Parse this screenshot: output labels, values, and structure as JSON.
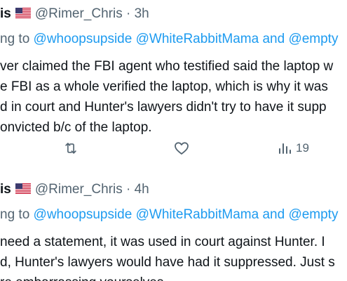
{
  "tweets": [
    {
      "display_name_fragment": "is",
      "handle": "@Rimer_Chris",
      "separator": "·",
      "time": "3h",
      "replying_prefix": "ng to",
      "mentions": [
        "@whoopsupside",
        "@WhiteRabbitMama",
        "and",
        "@empty"
      ],
      "body_lines": [
        "ver claimed the FBI agent who testified said the laptop w",
        "e FBI as a whole verified the laptop, which is why it was",
        "d in court and Hunter's lawyers didn't try to have it supp",
        "onvicted b/c of the laptop."
      ],
      "actions": {
        "retweet_icon": "retweet-icon",
        "like_icon": "heart-icon",
        "views_icon": "views-bar-chart-icon",
        "views_count": "19"
      }
    },
    {
      "display_name_fragment": "is",
      "handle": "@Rimer_Chris",
      "separator": "·",
      "time": "4h",
      "replying_prefix": "ng to",
      "mentions": [
        "@whoopsupside",
        "@WhiteRabbitMama",
        "and",
        "@empty"
      ],
      "body_lines": [
        "need a statement,  it was used in court against Hunter. I",
        "d, Hunter's lawyers would have had it suppressed. Just s",
        "re embarrassing yourselves."
      ]
    }
  ],
  "colors": {
    "text_primary": "#0f1419",
    "text_secondary": "#536471",
    "link": "#1d9bf0",
    "background": "#ffffff"
  },
  "flag_icon": "us-flag-icon"
}
